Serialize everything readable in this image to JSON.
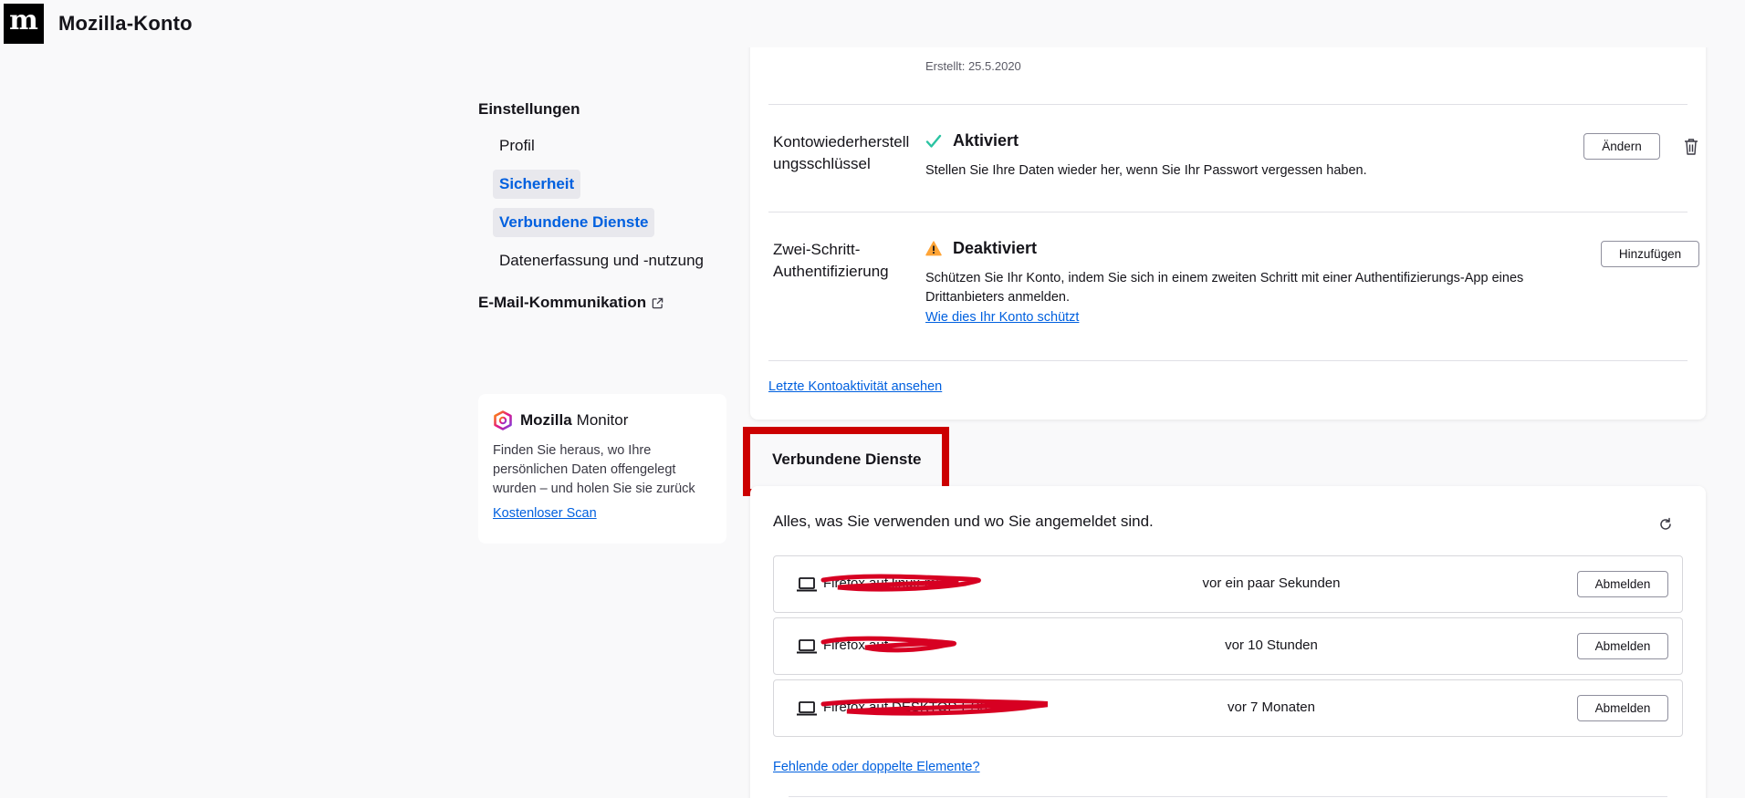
{
  "header": {
    "logo_glyph": "m",
    "title": "Mozilla-Konto"
  },
  "nav": {
    "heading": "Einstellungen",
    "items": [
      {
        "label": "Profil",
        "active": false
      },
      {
        "label": "Sicherheit",
        "active": true
      },
      {
        "label": "Verbundene Dienste",
        "active": true
      },
      {
        "label": "Datenerfassung und -nutzung",
        "active": false
      }
    ],
    "mail_label": "E-Mail-Kommunikation",
    "mail_icon": "external-link-icon"
  },
  "promo": {
    "brand_bold": "Mozilla",
    "brand_rest": "Monitor",
    "text": "Finden Sie heraus, wo Ihre persönlichen Daten offengelegt wurden – und holen Sie sie zurück",
    "link": "Kostenloser Scan"
  },
  "security": {
    "created": "Erstellt: 25.5.2020",
    "recovery": {
      "label": "Kontowiederherstellungsschlüssel",
      "status": "Aktiviert",
      "status_icon": "checkmark-icon",
      "desc": "Stellen Sie Ihre Daten wieder her, wenn Sie Ihr Passwort vergessen haben.",
      "button": "Ändern",
      "delete_icon": "trash-icon"
    },
    "twofa": {
      "label": "Zwei-Schritt-Authentifizierung",
      "status": "Deaktiviert",
      "status_icon": "warning-icon",
      "desc": "Schützen Sie Ihr Konto, indem Sie sich in einem zweiten Schritt mit einer Authentifizierungs-App eines Drittanbieters anmelden.",
      "link": "Wie dies Ihr Konto schützt",
      "button": "Hinzufügen"
    },
    "activity_link": "Letzte Kontoaktivität ansehen"
  },
  "services": {
    "title": "Verbundene Dienste",
    "intro": "Alles, was Sie verwenden und wo Sie angemeldet sind.",
    "refresh_icon": "refresh-icon",
    "devices": [
      {
        "name": "Firefox auf linux-mi",
        "when": "vor ein paar Sekunden",
        "button": "Abmelden"
      },
      {
        "name": "Firefox auf",
        "when": "vor 10 Stunden",
        "button": "Abmelden"
      },
      {
        "name": "Firefox auf DESKTOP-ES0",
        "when": "vor 7 Monaten",
        "button": "Abmelden"
      }
    ],
    "missing_link": "Fehlende oder doppelte Elemente?"
  },
  "colors": {
    "accent": "#0060df",
    "success": "#2ac3a2",
    "warning": "#ffa436",
    "highlight": "#cc0000",
    "redaction": "#d70022"
  }
}
